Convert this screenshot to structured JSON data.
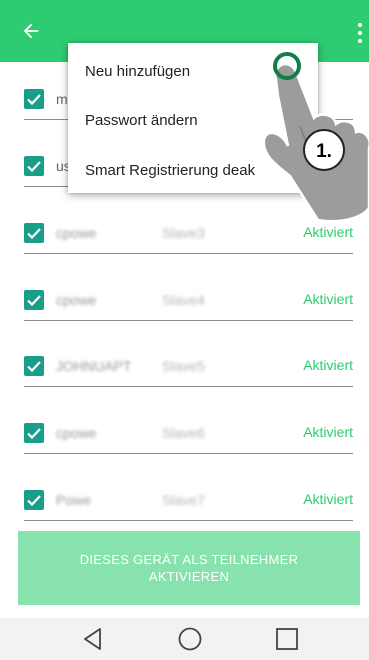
{
  "colors": {
    "appbar": "#2ecc71",
    "checkbox": "#189f8a",
    "status_text": "#2ecc71",
    "primary_button_disabled": "#88e2ad",
    "navbar": "#f2f2f2"
  },
  "appbar": {
    "back_icon": "arrow-left-icon",
    "overflow_icon": "more-vert-icon"
  },
  "menu": {
    "items": [
      {
        "label": "Neu hinzufügen"
      },
      {
        "label": "Passwort ändern"
      },
      {
        "label": "Smart Registrierung deak"
      }
    ]
  },
  "list": {
    "rows": [
      {
        "name": "m",
        "device": "",
        "status": "",
        "checked": true
      },
      {
        "name": "us",
        "device": "",
        "status": "",
        "checked": true
      },
      {
        "name": "cpowe",
        "device": "Slave3",
        "status": "Aktiviert",
        "checked": true
      },
      {
        "name": "cpowe",
        "device": "Slave4",
        "status": "Aktiviert",
        "checked": true
      },
      {
        "name": "JOHNUAPT",
        "device": "Slave5",
        "status": "Aktiviert",
        "checked": true
      },
      {
        "name": "cpowe",
        "device": "Slave6",
        "status": "Aktiviert",
        "checked": true
      },
      {
        "name": "Powe",
        "device": "Slave7",
        "status": "Aktiviert",
        "checked": true
      }
    ]
  },
  "action_button": {
    "label": "DIESES GERÄT ALS TEILNEHMER AKTIVIEREN"
  },
  "annotation": {
    "step_label": "1."
  },
  "navbar": {
    "back_icon": "triangle-back-icon",
    "home_icon": "circle-home-icon",
    "recents_icon": "square-recents-icon"
  }
}
